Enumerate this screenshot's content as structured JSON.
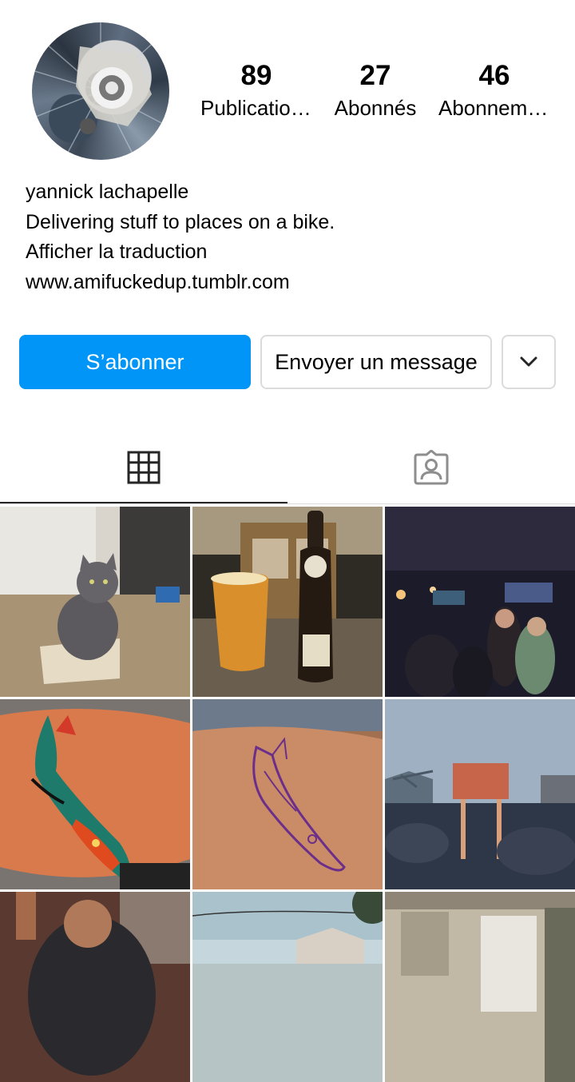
{
  "profile": {
    "avatar_icon": "bicycle-hub-photo",
    "stats": [
      {
        "count": "89",
        "label": "Publications"
      },
      {
        "count": "27",
        "label": "Abonnés"
      },
      {
        "count": "46",
        "label": "Abonnements"
      }
    ]
  },
  "bio": {
    "name": "yannick lachapelle",
    "text": "Delivering stuff to places on a bike.",
    "translate_link": "Afficher la traduction",
    "website": "www.amifuckedup.tumblr.com"
  },
  "actions": {
    "follow_label": "S’abonner",
    "message_label": "Envoyer un message",
    "more_icon": "chevron-down-icon",
    "colors": {
      "follow": "#0095f6",
      "border": "#dbdbdb"
    }
  },
  "tabs": [
    {
      "name": "grid",
      "icon": "grid-icon",
      "active": true
    },
    {
      "name": "tagged",
      "icon": "tagged-person-icon",
      "active": false
    }
  ],
  "posts": [
    {
      "subject": "grey cat in cardboard box"
    },
    {
      "subject": "glass of beer and Double IPA bottle"
    },
    {
      "subject": "crowded dim bar interior"
    },
    {
      "subject": "colourful fish tattoo on arm"
    },
    {
      "subject": "purple stencil outline tattoo on arm"
    },
    {
      "subject": "outdoor event crowd near bridge"
    },
    {
      "subject": "person in security shirt"
    },
    {
      "subject": "street with trees and sky"
    },
    {
      "subject": "room interior with window"
    }
  ]
}
